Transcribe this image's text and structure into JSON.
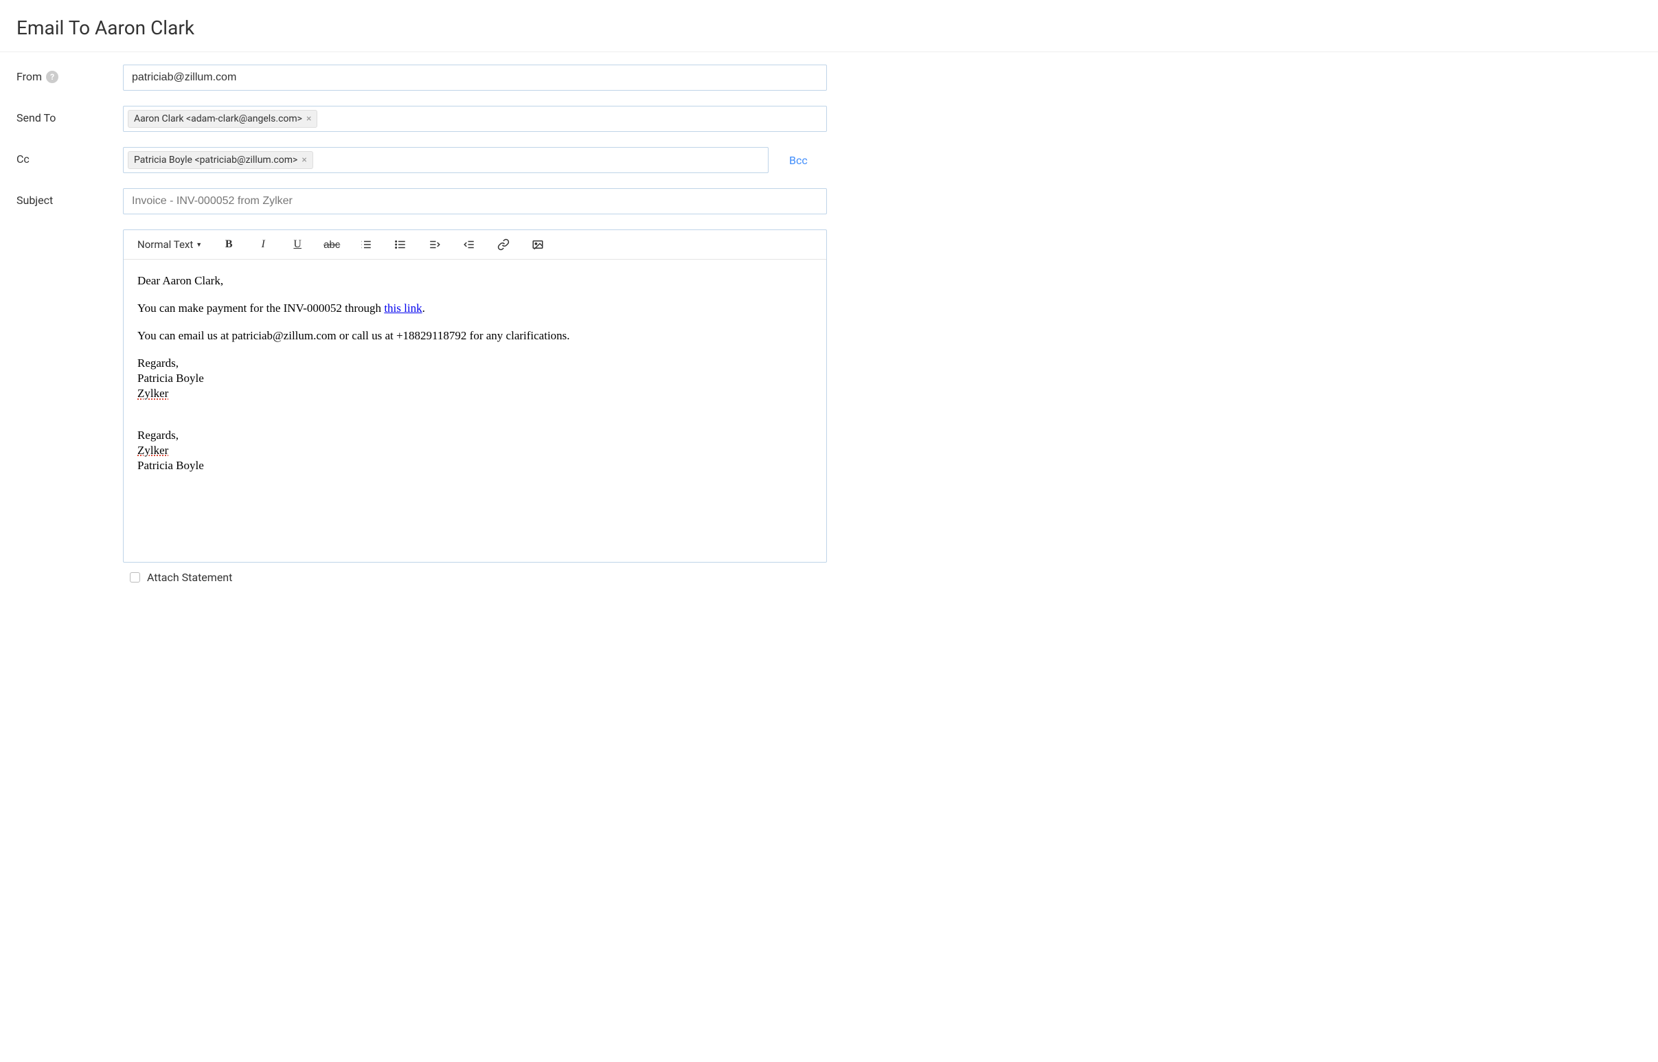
{
  "header": {
    "title": "Email To Aaron Clark"
  },
  "form": {
    "from": {
      "label": "From",
      "value": "patriciab@zillum.com"
    },
    "sendTo": {
      "label": "Send To",
      "chips": [
        "Aaron Clark <adam-clark@angels.com>"
      ]
    },
    "cc": {
      "label": "Cc",
      "chips": [
        "Patricia Boyle <patriciab@zillum.com>"
      ],
      "bccLabel": "Bcc"
    },
    "subject": {
      "label": "Subject",
      "value": "Invoice - INV-000052 from Zylker"
    }
  },
  "toolbar": {
    "formatLabel": "Normal Text",
    "bold": "B",
    "italic": "I",
    "underline": "U",
    "strike": "abc"
  },
  "body": {
    "greeting": "Dear Aaron Clark,",
    "line1a": "You can make payment for the INV-000052 through ",
    "line1link": "this link",
    "line1b": ".",
    "line2": "You can email us at patriciab@zillum.com or call us at +18829118792 for any clarifications.",
    "sig1_l1": "Regards,",
    "sig1_l2": "Patricia Boyle",
    "sig1_l3": "Zylker",
    "sig2_l1": "Regards,",
    "sig2_l2": "Zylker",
    "sig2_l3": "Patricia Boyle"
  },
  "attach": {
    "label": "Attach Statement",
    "checked": false
  }
}
